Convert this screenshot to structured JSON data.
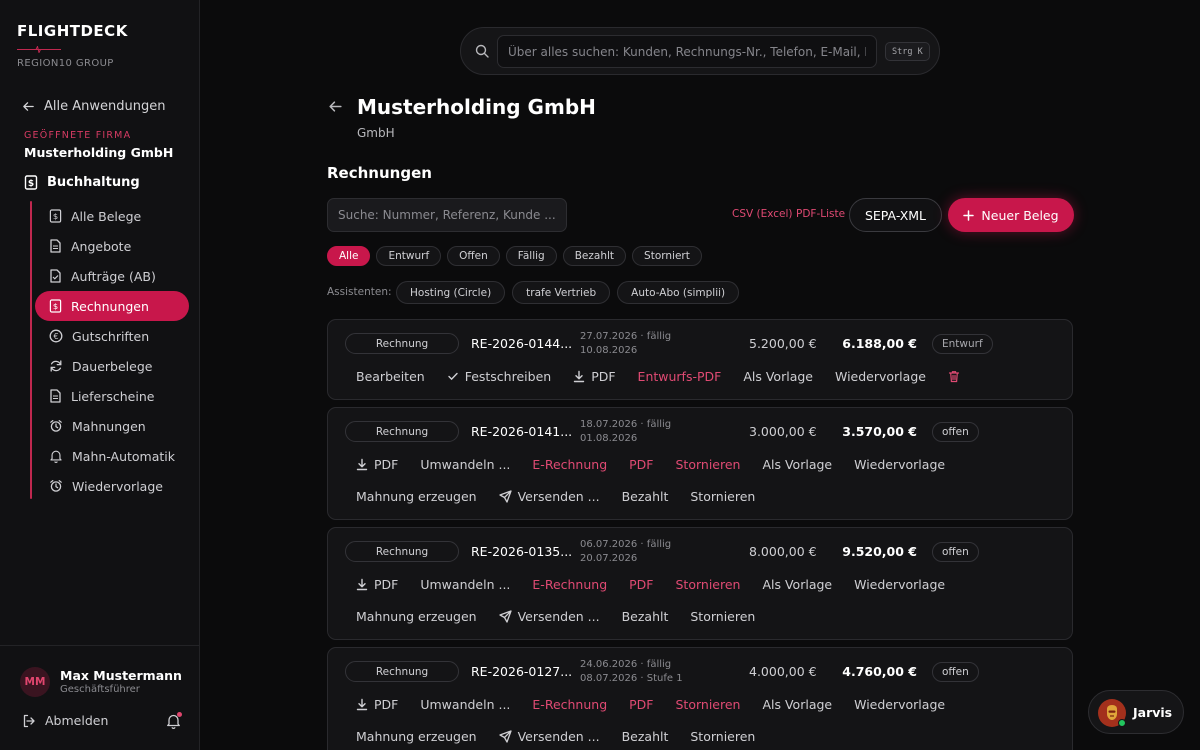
{
  "brand": {
    "title": "FLIGHTDECK",
    "subtitle": "REGION10 GROUP"
  },
  "sidebar": {
    "back_label": "Alle Anwendungen",
    "firm_label": "GEÖFFNETE FIRMA",
    "firm_name": "Musterholding GmbH",
    "section_label": "Buchhaltung",
    "items": [
      {
        "label": "Alle Belege",
        "icon": "receipt-icon"
      },
      {
        "label": "Angebote",
        "icon": "document-icon"
      },
      {
        "label": "Aufträge (AB)",
        "icon": "document-check-icon"
      },
      {
        "label": "Rechnungen",
        "icon": "receipt-icon",
        "active": true
      },
      {
        "label": "Gutschriften",
        "icon": "euro-circle-icon"
      },
      {
        "label": "Dauerbelege",
        "icon": "refresh-icon"
      },
      {
        "label": "Lieferscheine",
        "icon": "document-icon"
      },
      {
        "label": "Mahnungen",
        "icon": "alarm-icon"
      },
      {
        "label": "Mahn-Automatik",
        "icon": "bell-icon"
      },
      {
        "label": "Wiedervorlage",
        "icon": "alarm-icon"
      }
    ],
    "user": {
      "initials": "MM",
      "name": "Max Mustermann",
      "role": "Geschäftsführer"
    },
    "logout_label": "Abmelden"
  },
  "search": {
    "placeholder": "Über alles suchen: Kunden, Rechnungs-Nr., Telefon, E-Mail, Mo",
    "shortcut": "Strg K"
  },
  "header": {
    "title": "Musterholding GmbH",
    "subtitle": "GmbH"
  },
  "invoices": {
    "section_title": "Rechnungen",
    "filter_placeholder": "Suche: Nummer, Referenz, Kunde ...",
    "csv_label": "CSV (Excel)",
    "pdf_list_label": "PDF-Liste",
    "sepa_label": "SEPA-XML",
    "new_label": "Neuer Beleg",
    "status_filters": [
      "Alle",
      "Entwurf",
      "Offen",
      "Fällig",
      "Bezahlt",
      "Storniert"
    ],
    "assist_label": "Assistenten:",
    "assistants": [
      "Hosting (Circle)",
      "trafe Vertrieb",
      "Auto-Abo (simplii)"
    ],
    "rows": [
      {
        "type": "Rechnung",
        "number": "RE-2026-0144...",
        "date1": "27.07.2026 · fällig",
        "date2": "10.08.2026",
        "net": "5.200,00 €",
        "gross": "6.188,00 €",
        "status": "Entwurf",
        "action_rows": [
          [
            "Bearbeiten",
            "Festschreiben",
            "PDF",
            "Entwurfs-PDF",
            "Als Vorlage",
            "Wiedervorlage"
          ]
        ]
      },
      {
        "type": "Rechnung",
        "number": "RE-2026-0141...",
        "date1": "18.07.2026 · fällig",
        "date2": "01.08.2026",
        "net": "3.000,00 €",
        "gross": "3.570,00 €",
        "status": "offen",
        "action_rows": [
          [
            "PDF",
            "Umwandeln ...",
            "E-Rechnung",
            "PDF",
            "Stornieren",
            "Als Vorlage",
            "Wiedervorlage"
          ],
          [
            "Mahnung erzeugen",
            "Versenden ...",
            "Bezahlt",
            "Stornieren"
          ]
        ]
      },
      {
        "type": "Rechnung",
        "number": "RE-2026-0135...",
        "date1": "06.07.2026 · fällig",
        "date2": "20.07.2026",
        "net": "8.000,00 €",
        "gross": "9.520,00 €",
        "status": "offen",
        "action_rows": [
          [
            "PDF",
            "Umwandeln ...",
            "E-Rechnung",
            "PDF",
            "Stornieren",
            "Als Vorlage",
            "Wiedervorlage"
          ],
          [
            "Mahnung erzeugen",
            "Versenden ...",
            "Bezahlt",
            "Stornieren"
          ]
        ]
      },
      {
        "type": "Rechnung",
        "number": "RE-2026-0127...",
        "date1": "24.06.2026 · fällig",
        "date2": "08.07.2026 · Stufe 1",
        "net": "4.000,00 €",
        "gross": "4.760,00 €",
        "status": "offen",
        "action_rows": [
          [
            "PDF",
            "Umwandeln ...",
            "E-Rechnung",
            "PDF",
            "Stornieren",
            "Als Vorlage",
            "Wiedervorlage"
          ],
          [
            "Mahnung erzeugen",
            "Versenden ...",
            "Bezahlt",
            "Stornieren"
          ]
        ]
      }
    ]
  },
  "assistant": {
    "name": "Jarvis"
  },
  "colors": {
    "accent": "#c8174b",
    "accent_text": "#e04a73",
    "online": "#22c55e"
  }
}
